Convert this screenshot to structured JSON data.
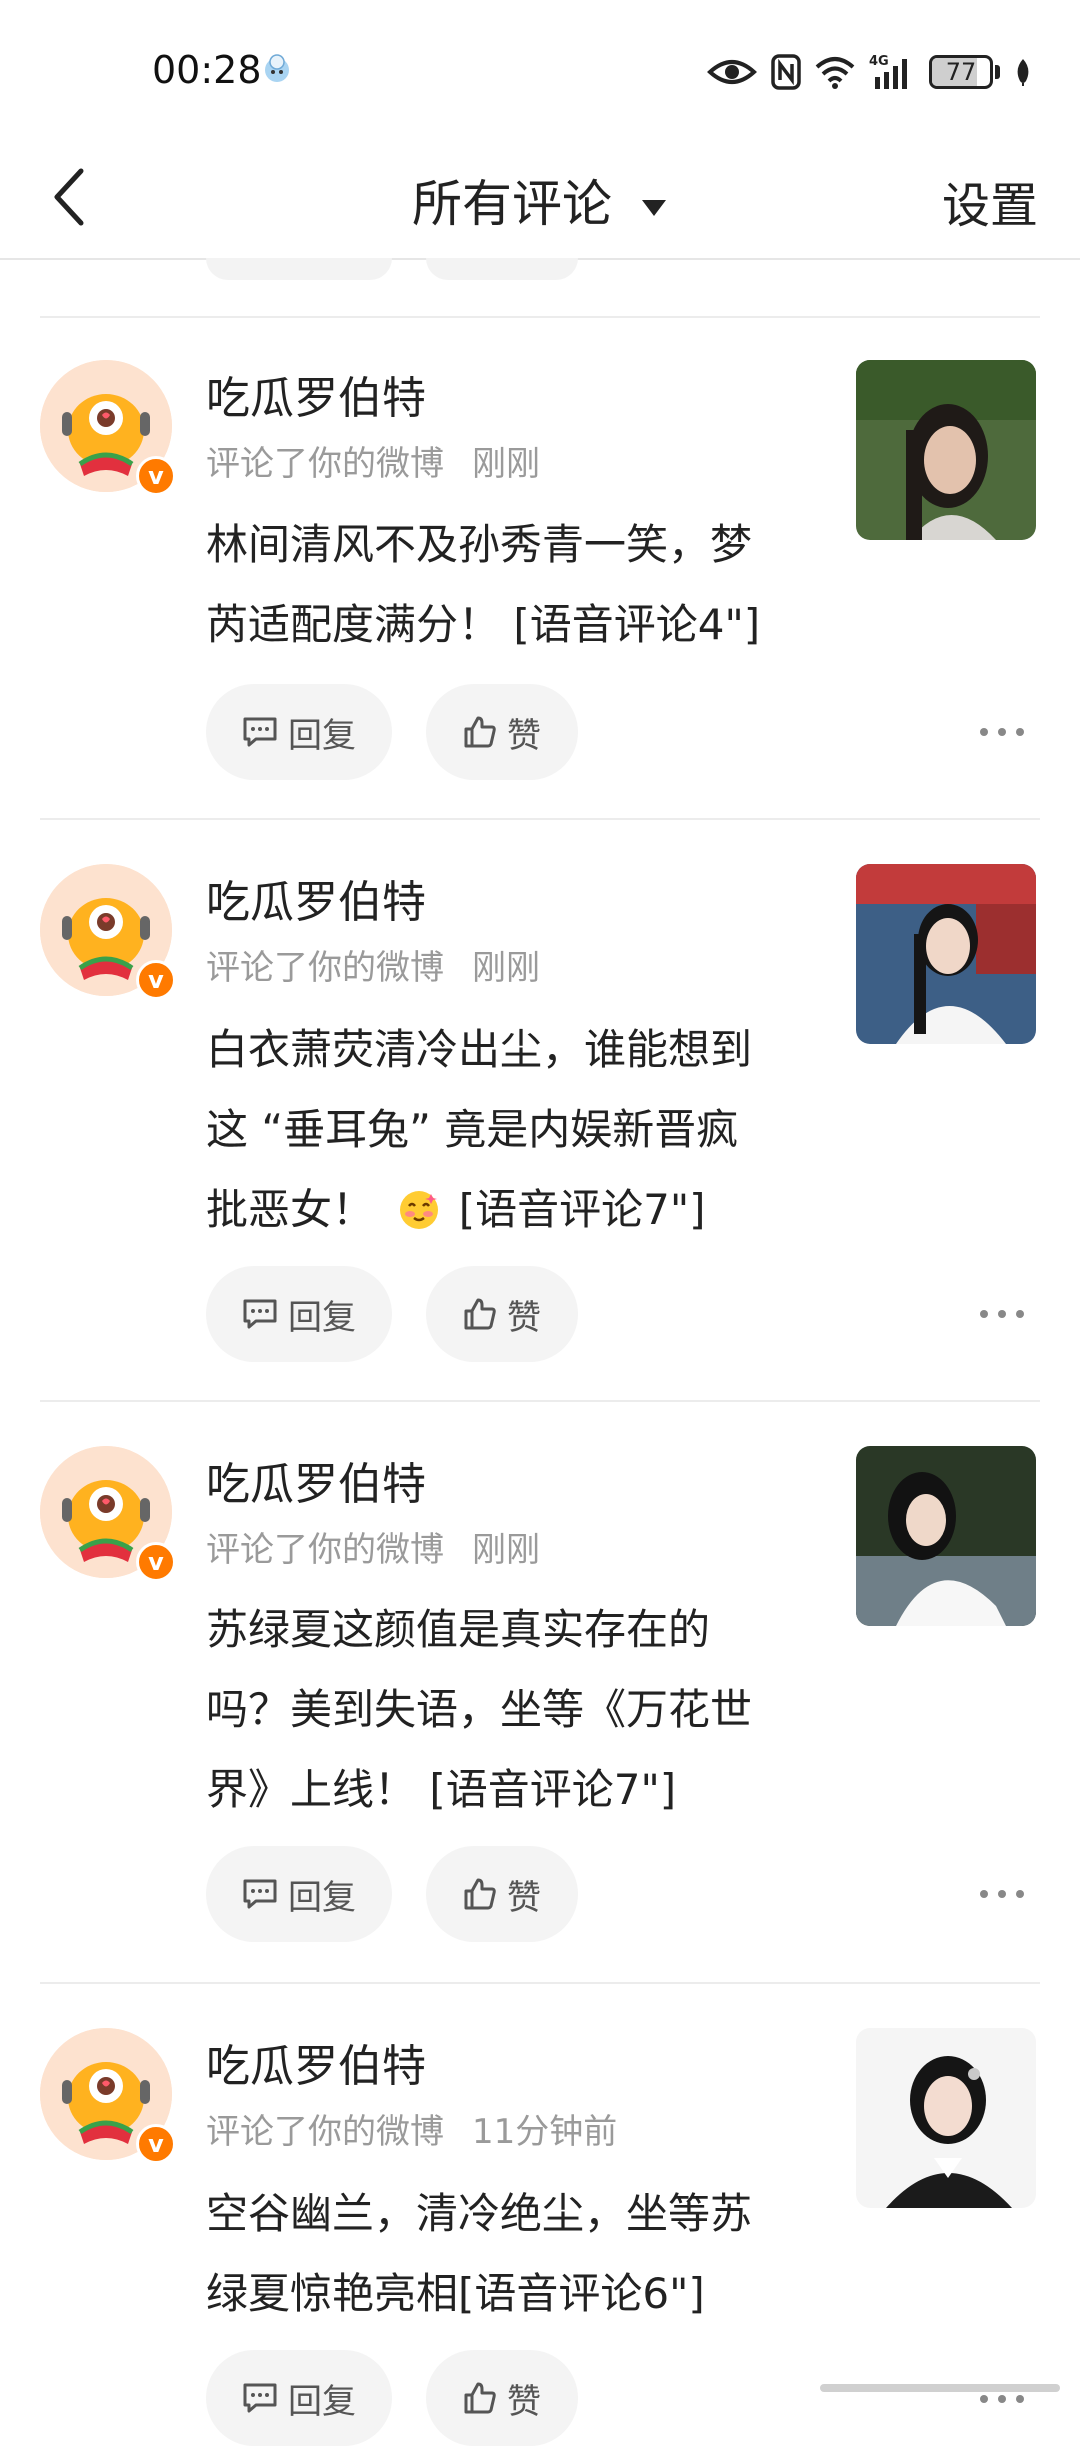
{
  "status_bar": {
    "time": "00:28",
    "battery": "77",
    "battery_level_percent": 77,
    "network": "4G",
    "icons": [
      "eye-icon",
      "nfc-icon",
      "wifi-icon",
      "signal-icon",
      "battery-icon",
      "leaf-icon"
    ]
  },
  "header": {
    "title": "所有评论",
    "settings_label": "设置"
  },
  "comments": [
    {
      "username": "吃瓜罗伯特",
      "action": "评论了你的微博",
      "time": "刚刚",
      "lines": [
        "林间清风不及孙秀青一笑，梦",
        "芮适配度满分！ [语音评论4\"]"
      ],
      "reply_label": "回复",
      "like_label": "赞"
    },
    {
      "username": "吃瓜罗伯特",
      "action": "评论了你的微博",
      "time": "刚刚",
      "lines": [
        "白衣萧荧清冷出尘，谁能想到",
        "这 “垂耳兔” 竟是内娱新晋疯",
        "批恶女！",
        "[语音评论7\"]"
      ],
      "reply_label": "回复",
      "like_label": "赞"
    },
    {
      "username": "吃瓜罗伯特",
      "action": "评论了你的微博",
      "time": "刚刚",
      "lines": [
        "苏绿夏这颜值是真实存在的",
        "吗？美到失语，坐等《万花世",
        "界》上线！ [语音评论7\"]"
      ],
      "reply_label": "回复",
      "like_label": "赞"
    },
    {
      "username": "吃瓜罗伯特",
      "action": "评论了你的微博",
      "time": "11分钟前",
      "lines": [
        "空谷幽兰，清冷绝尘，坐等苏",
        "绿夏惊艳亮相[语音评论6\"]"
      ],
      "reply_label": "回复",
      "like_label": "赞"
    }
  ],
  "colors": {
    "badge": "#ff7a00",
    "button_bg": "#f4f4f4",
    "meta_text": "#9a9a9a"
  }
}
